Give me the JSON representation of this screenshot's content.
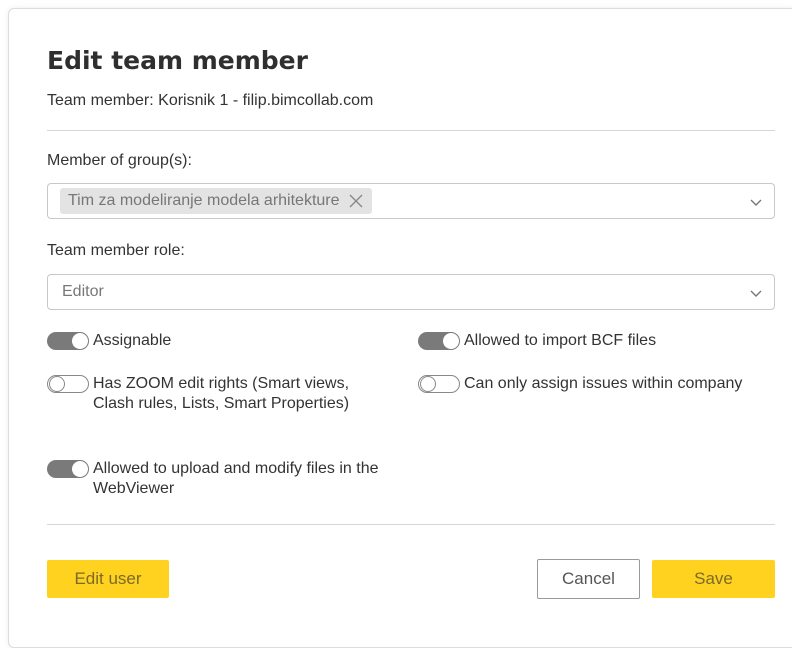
{
  "dialog": {
    "title": "Edit team member",
    "subtitle": "Team member: Korisnik 1 - filip.bimcollab.com"
  },
  "groups": {
    "label": "Member of group(s):",
    "selected_chip": "Tim za modeliranje modela arhitekture"
  },
  "role": {
    "label": "Team member role:",
    "value": "Editor"
  },
  "toggles": {
    "assignable": {
      "label": "Assignable",
      "on": true
    },
    "import_bcf": {
      "label": "Allowed to import BCF files",
      "on": true
    },
    "zoom_edit": {
      "label": "Has ZOOM edit rights (Smart views, Clash rules, Lists, Smart Properties)",
      "on": false
    },
    "assign_within_company": {
      "label": "Can only assign issues within company",
      "on": false
    },
    "upload_files": {
      "label": "Allowed to upload and modify files in the WebViewer",
      "on": true
    }
  },
  "buttons": {
    "edit_user": "Edit user",
    "cancel": "Cancel",
    "save": "Save"
  },
  "colors": {
    "accent_yellow": "#ffd21f",
    "toggle_on": "#7a7a7a"
  }
}
